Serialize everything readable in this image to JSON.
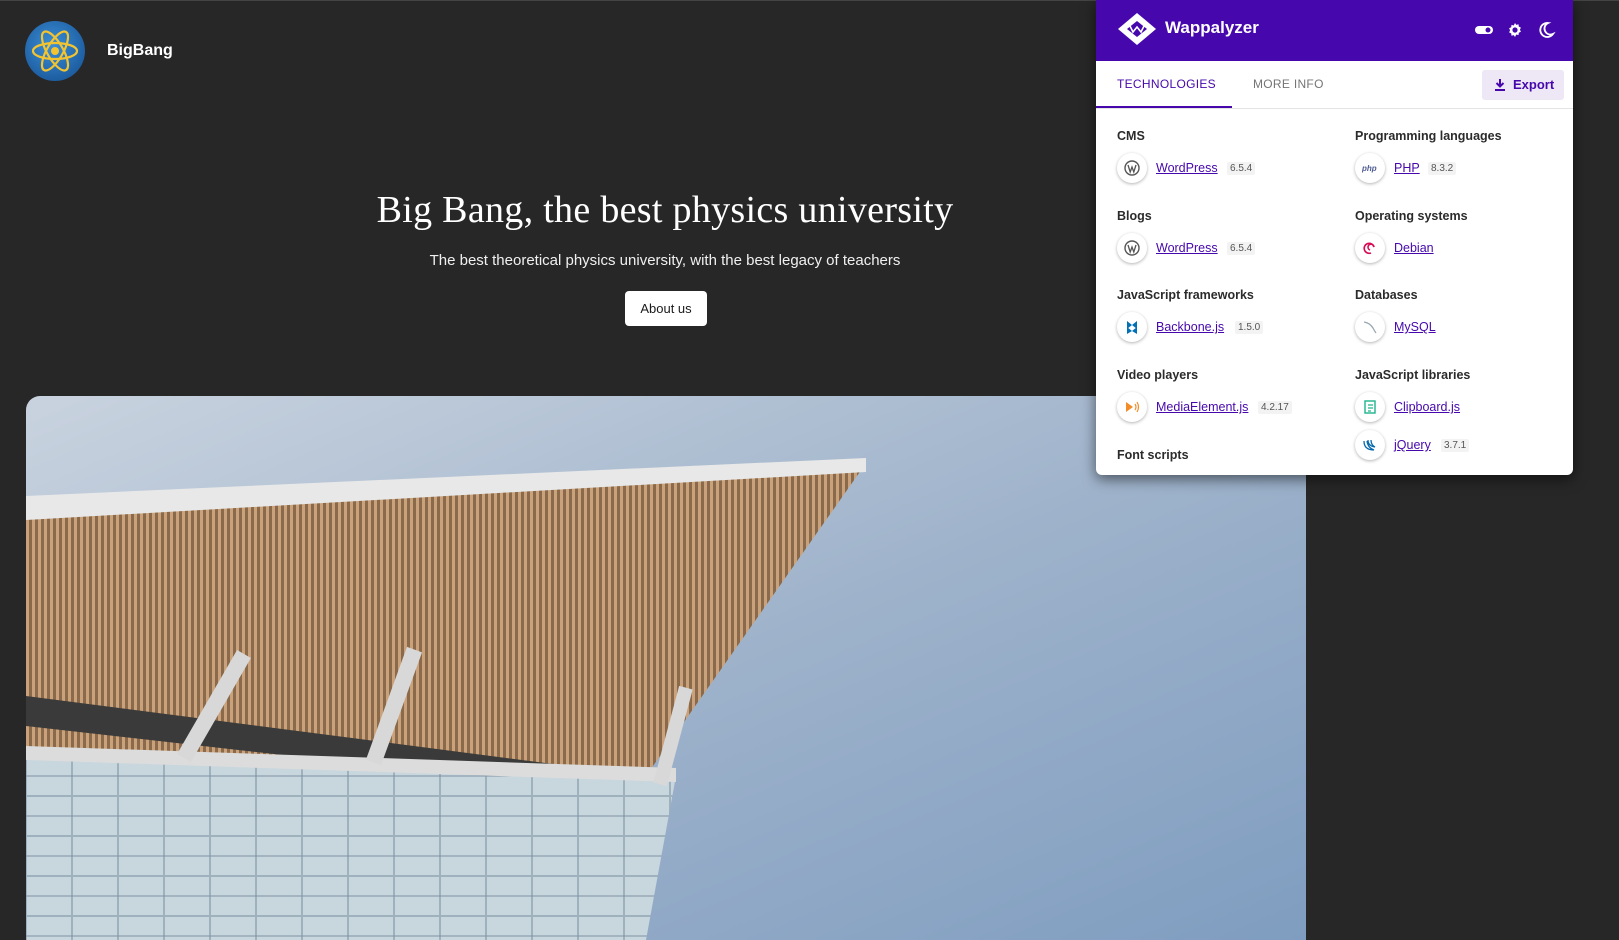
{
  "site": {
    "name": "BigBang",
    "hero_title": "Big Bang, the best physics university",
    "hero_subtitle": "The best theoretical physics university, with the best legacy of teachers",
    "about_button": "About us",
    "logo_icon": "atom-icon"
  },
  "wappalyzer": {
    "title": "Wappalyzer",
    "header_icons": [
      "toggle-icon",
      "gear-icon",
      "moon-icon"
    ],
    "tabs": [
      "TECHNOLOGIES",
      "MORE INFO"
    ],
    "export_label": "Export",
    "left_column": {
      "cms": {
        "label": "CMS",
        "tech": {
          "name": "WordPress",
          "version": "6.5.4"
        }
      },
      "blogs": {
        "label": "Blogs",
        "tech": {
          "name": "WordPress",
          "version": "6.5.4"
        }
      },
      "js_frameworks": {
        "label": "JavaScript frameworks",
        "tech": {
          "name": "Backbone.js",
          "version": "1.5.0"
        }
      },
      "video_players": {
        "label": "Video players",
        "tech": {
          "name": "MediaElement.js",
          "version": "4.2.17"
        }
      },
      "font_scripts": {
        "label": "Font scripts"
      }
    },
    "right_column": {
      "programming_languages": {
        "label": "Programming languages",
        "tech": {
          "name": "PHP",
          "version": "8.3.2"
        }
      },
      "operating_systems": {
        "label": "Operating systems",
        "tech": {
          "name": "Debian"
        }
      },
      "databases": {
        "label": "Databases",
        "tech": {
          "name": "MySQL"
        }
      },
      "js_libraries": {
        "label": "JavaScript libraries",
        "techs": [
          {
            "name": "Clipboard.js"
          },
          {
            "name": "jQuery",
            "version": "3.7.1"
          }
        ]
      }
    },
    "colors": {
      "brand": "#4608ad",
      "export_bg": "#ede7f6"
    }
  }
}
